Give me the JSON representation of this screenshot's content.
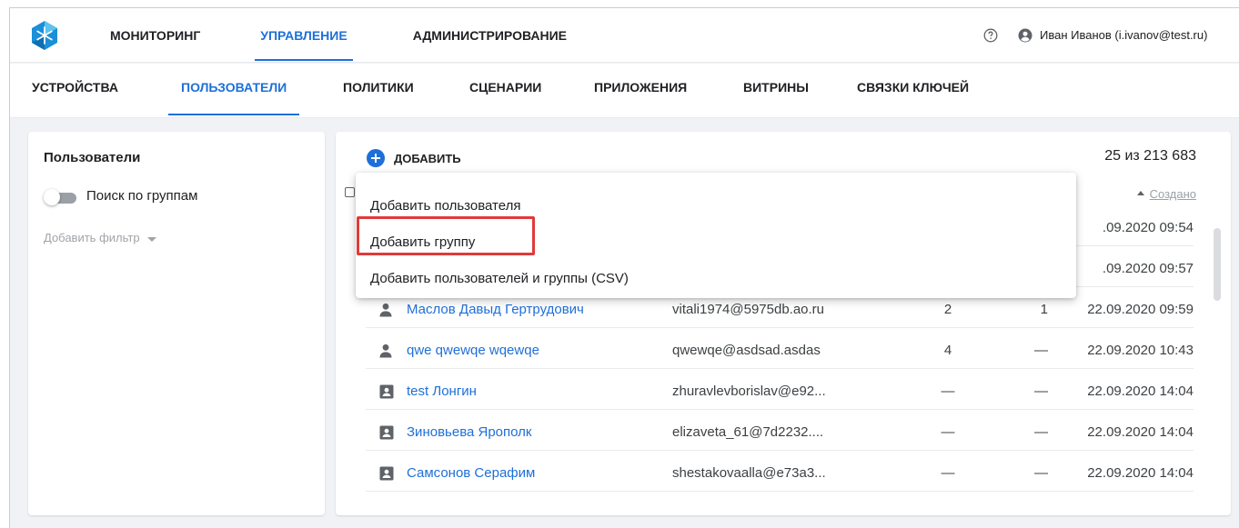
{
  "header": {
    "nav": [
      {
        "label": "МОНИТОРИНГ",
        "active": false
      },
      {
        "label": "УПРАВЛЕНИЕ",
        "active": true
      },
      {
        "label": "АДМИНИСТРИРОВАНИЕ",
        "active": false
      }
    ],
    "user": "Иван Иванов (i.ivanov@test.ru)",
    "logo_icon": "hexagon-snowflake-logo",
    "help_icon": "question-circle-icon",
    "user_icon": "account-circle-icon"
  },
  "subnav": {
    "tabs": [
      {
        "label": "УСТРОЙСТВА",
        "active": false
      },
      {
        "label": "ПОЛЬЗОВАТЕЛИ",
        "active": true
      },
      {
        "label": "ПОЛИТИКИ",
        "active": false
      },
      {
        "label": "СЦЕНАРИИ",
        "active": false
      },
      {
        "label": "ПРИЛОЖЕНИЯ",
        "active": false
      },
      {
        "label": "ВИТРИНЫ",
        "active": false
      },
      {
        "label": "СВЯЗКИ КЛЮЧЕЙ",
        "active": false
      }
    ]
  },
  "sidebar": {
    "title": "Пользователи",
    "toggle_label": "Поиск по группам",
    "toggle_on": false,
    "add_filter": "Добавить фильтр"
  },
  "main": {
    "add_label": "ДОБАВИТЬ",
    "count": "25 из 213 683",
    "sort_label": "Создано",
    "rows": [
      {
        "icon": "person-icon",
        "name": "",
        "email": "",
        "n1": "",
        "n2": "",
        "date": ".09.2020 09:54"
      },
      {
        "icon": "person-icon",
        "name": "",
        "email": "",
        "n1": "",
        "n2": "",
        "date": ".09.2020 09:57"
      },
      {
        "icon": "person-icon",
        "name": "Маслов Давыд Гертрудович",
        "email": "vitali1974@5975db.ao.ru",
        "n1": "2",
        "n2": "1",
        "date": "22.09.2020 09:59"
      },
      {
        "icon": "person-icon",
        "name": "qwe qwewqe wqewqe",
        "email": "qwewqe@asdsad.asdas",
        "n1": "4",
        "n2": "—",
        "date": "22.09.2020 10:43"
      },
      {
        "icon": "contact-card-icon",
        "name": "test Лонгин",
        "email": "zhuravlevborislav@e92...",
        "n1": "—",
        "n2": "—",
        "date": "22.09.2020 14:04"
      },
      {
        "icon": "contact-card-icon",
        "name": "Зиновьева Ярополк",
        "email": "elizaveta_61@7d2232....",
        "n1": "—",
        "n2": "—",
        "date": "22.09.2020 14:04"
      },
      {
        "icon": "contact-card-icon",
        "name": "Самсонов Серафим",
        "email": "shestakovaalla@e73a3...",
        "n1": "—",
        "n2": "—",
        "date": "22.09.2020 14:04"
      }
    ]
  },
  "dropdown": {
    "options": [
      "Добавить пользователя",
      "Добавить группу",
      "Добавить пользователей и группы (CSV)"
    ],
    "highlighted_index": 1
  },
  "colors": {
    "accent": "#1e6fd9",
    "highlight": "#e03a3a",
    "background": "#f0f2f5"
  }
}
